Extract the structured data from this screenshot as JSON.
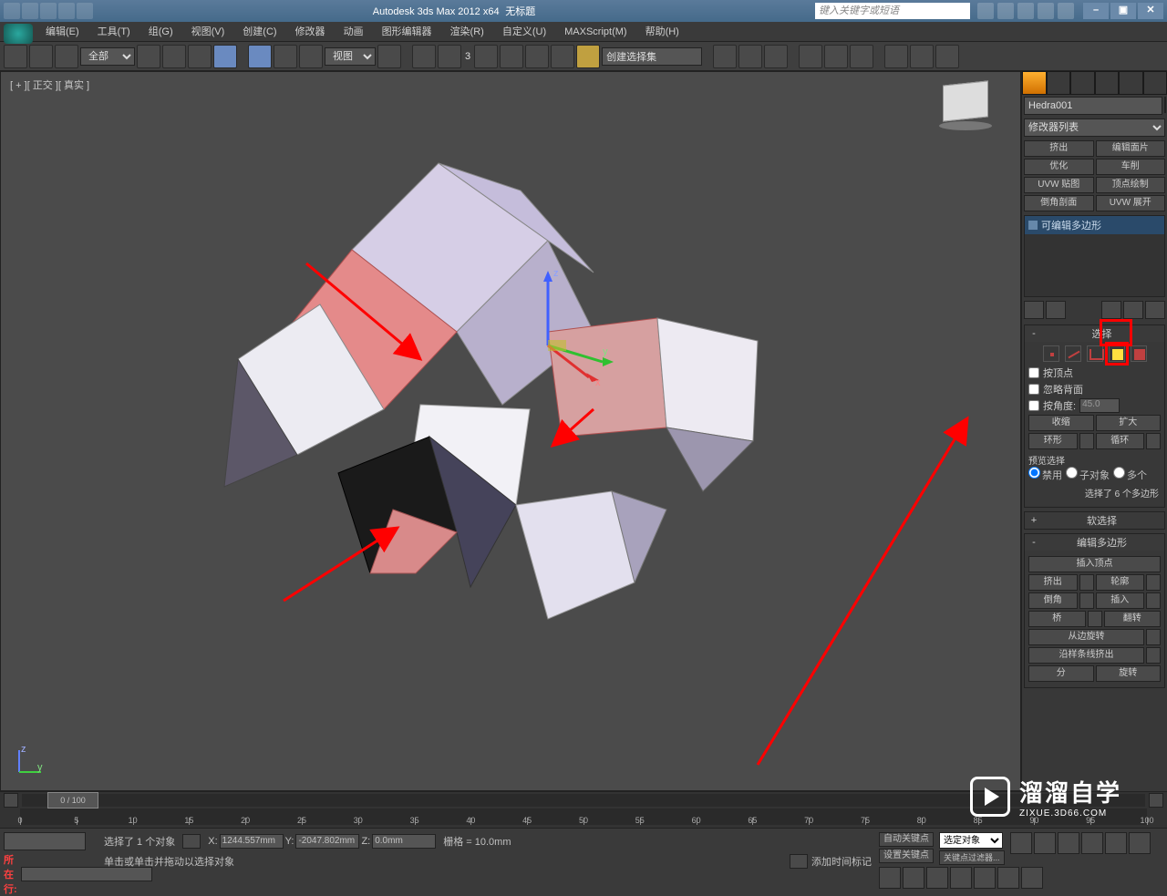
{
  "titlebar": {
    "app_title": "Autodesk 3ds Max 2012 x64",
    "doc_title": "无标题",
    "search_placeholder": "键入关键字或短语"
  },
  "window_buttons": {
    "min": "–",
    "max": "▣",
    "close": "✕"
  },
  "menus": [
    "编辑(E)",
    "工具(T)",
    "组(G)",
    "视图(V)",
    "创建(C)",
    "修改器",
    "动画",
    "图形编辑器",
    "渲染(R)",
    "自定义(U)",
    "MAXScript(M)",
    "帮助(H)"
  ],
  "toolbar": {
    "selection_filter": "全部",
    "ref_coord": "视图",
    "named_sel": "创建选择集",
    "three_label": "3"
  },
  "viewport": {
    "label": "[ + ][ 正交 ][ 真实 ]",
    "axis": {
      "x": "x",
      "y": "y",
      "z": "z"
    }
  },
  "cmdpanel": {
    "object_name": "Hedra001",
    "mod_list_label": "修改器列表",
    "preset_buttons": [
      "挤出",
      "编辑面片",
      "优化",
      "车削",
      "UVW 贴图",
      "顶点绘制",
      "倒角剖面",
      "UVW 展开"
    ],
    "stack_item": "可编辑多边形",
    "rollouts": {
      "selection": {
        "title": "选择",
        "by_vertex": "按顶点",
        "ignore_backfacing": "忽略背面",
        "by_angle": "按角度:",
        "angle_val": "45.0",
        "shrink": "收缩",
        "grow": "扩大",
        "ring": "环形",
        "loop": "循环",
        "preview_label": "预览选择",
        "preview_off": "禁用",
        "preview_subobj": "子对象",
        "preview_multi": "多个",
        "sel_info": "选择了 6 个多边形"
      },
      "soft_sel": "软选择",
      "edit_poly": {
        "title": "编辑多边形",
        "insert_vertex": "插入顶点",
        "extrude": "挤出",
        "outline": "轮廓",
        "bevel": "倒角",
        "inset": "插入",
        "bridge": "桥",
        "flip": "翻转",
        "hinge": "从边旋转",
        "extrude_spline": "沿样条线挤出",
        "split": "分",
        "rotate": "旋转"
      }
    }
  },
  "trackbar": {
    "frame_label": "0 / 100",
    "ticks": [
      0,
      5,
      10,
      15,
      20,
      25,
      30,
      35,
      40,
      45,
      50,
      55,
      60,
      65,
      70,
      75,
      80,
      85,
      90,
      95,
      100
    ]
  },
  "status": {
    "script_label": "所在行:",
    "sel_text": "选择了 1 个对象",
    "prompt": "单击或单击并拖动以选择对象",
    "coord_x_label": "X:",
    "coord_x": "1244.557mm",
    "coord_y_label": "Y:",
    "coord_y": "-2047.802mm",
    "coord_z_label": "Z:",
    "coord_z": "0.0mm",
    "grid_label": "栅格 = 10.0mm",
    "add_time_tag": "添加时间标记",
    "auto_key": "自动关键点",
    "set_key": "设置关键点",
    "sel_dropdown": "选定对象",
    "key_filters": "关键点过滤器..."
  },
  "watermark": {
    "line1": "溜溜自学",
    "line2": "ZIXUE.3D66.COM"
  }
}
